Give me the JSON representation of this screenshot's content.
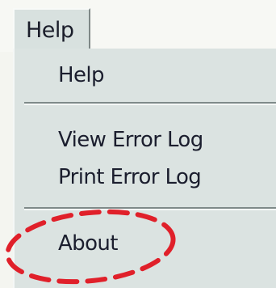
{
  "menubar": {
    "active_menu_label": "Help"
  },
  "dropdown": {
    "items": [
      {
        "label": "Help"
      },
      {
        "label": "View Error Log"
      },
      {
        "label": "Print Error Log"
      },
      {
        "label": "About"
      }
    ]
  },
  "colors": {
    "menu_background": "#dbe3e1",
    "text": "#1b1e2e",
    "annotation": "#e0202a"
  }
}
